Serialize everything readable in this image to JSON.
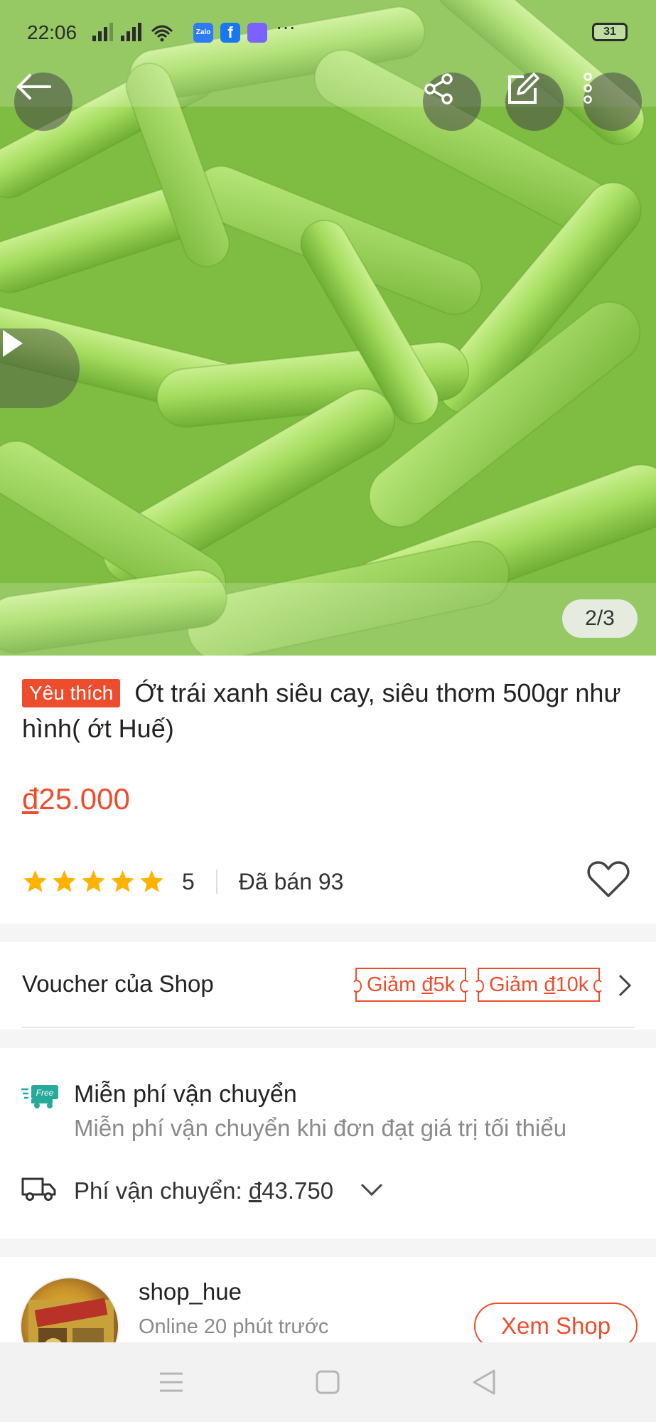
{
  "status_bar": {
    "time": "22:06",
    "more": "···",
    "battery": "31",
    "apps": [
      {
        "name": "zalo-icon",
        "label": "Zalo",
        "color": "#2f7bf5"
      },
      {
        "name": "facebook-icon",
        "label": "f",
        "color": "#1877f2"
      },
      {
        "name": "messenger-icon",
        "label": "",
        "color": "#7b61ff"
      }
    ]
  },
  "gallery": {
    "counter": "2/3"
  },
  "product": {
    "badge": "Yêu thích",
    "title": "Ớt trái xanh siêu cay, siêu thơm 500gr như hình( ớt Huế)",
    "price_currency": "đ",
    "price_amount": "25.000",
    "rating_value": 5,
    "rating_text": "5",
    "sold": "Đã bán 93"
  },
  "voucher": {
    "label": "Voucher của Shop",
    "tags": [
      {
        "prefix": "Giảm ",
        "currency": "đ",
        "amount": "5k"
      },
      {
        "prefix": "Giảm ",
        "currency": "đ",
        "amount": "10k"
      }
    ]
  },
  "shipping": {
    "free_badge": "Free",
    "free_title": "Miễn phí vận chuyển",
    "free_subtitle": "Miễn phí vận chuyển khi đơn đạt giá trị tối thiểu",
    "fee_label": "Phí vận chuyển: ",
    "fee_currency": "đ",
    "fee_amount": "43.750"
  },
  "shop": {
    "name": "shop_hue",
    "online": "Online 20 phút trước",
    "view_button": "Xem Shop"
  },
  "colors": {
    "accent": "#ee4d2d",
    "star": "#ffb300",
    "free_ship": "#26aa99"
  }
}
